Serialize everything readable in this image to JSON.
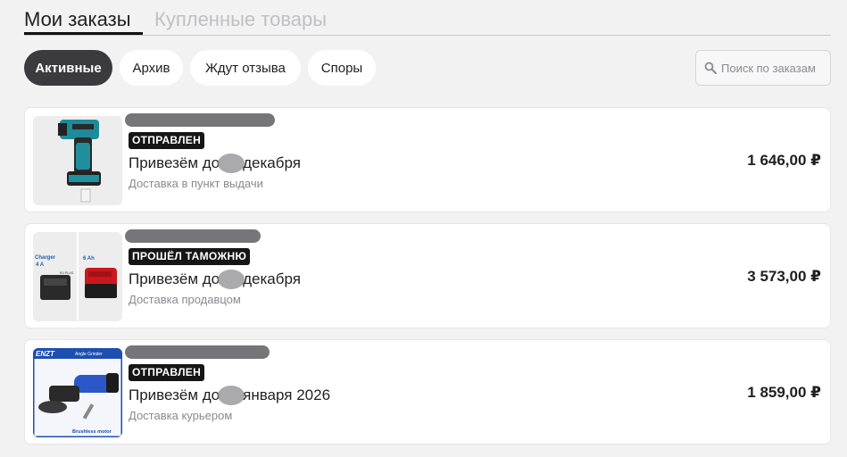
{
  "tabs": [
    {
      "label": "Мои заказы",
      "active": true
    },
    {
      "label": "Купленные товары",
      "active": false
    }
  ],
  "filters": [
    {
      "label": "Активные",
      "selected": true
    },
    {
      "label": "Архив",
      "selected": false
    },
    {
      "label": "Ждут отзыва",
      "selected": false
    },
    {
      "label": "Споры",
      "selected": false
    }
  ],
  "search": {
    "placeholder": "Поиск по заказам",
    "icon": "search-icon"
  },
  "orders": [
    {
      "status": "ОТПРАВЛЕН",
      "delivery_prefix": "Привезём до",
      "delivery_suffix": "декабря",
      "method": "Доставка в пункт выдачи",
      "price": "1 646,00 ₽",
      "thumbnail": "impact-driver-image"
    },
    {
      "status": "ПРОШЁЛ ТАМОЖНЮ",
      "delivery_prefix": "Привезём до",
      "delivery_suffix": "декабря",
      "method": "Доставка продавцом",
      "price": "3 573,00 ₽",
      "thumbnail": "charger-battery-image",
      "thumb_labels": {
        "charger": "Charger",
        "charger_amp": "4 A",
        "battery": "6 Ah",
        "plug": "EU PLUG"
      }
    },
    {
      "status": "ОТПРАВЛЕН",
      "delivery_prefix": "Привезём до",
      "delivery_suffix": "января 2026",
      "method": "Доставка курьером",
      "price": "1 859,00 ₽",
      "thumbnail": "angle-grinder-image",
      "thumb_labels": {
        "brand": "ENZT",
        "title": "Angle Grinder",
        "footer": "Brushless motor"
      }
    }
  ],
  "colors": {
    "selected_chip": "#3b3b3d",
    "badge": "#161616",
    "background": "#f2f2f3"
  }
}
